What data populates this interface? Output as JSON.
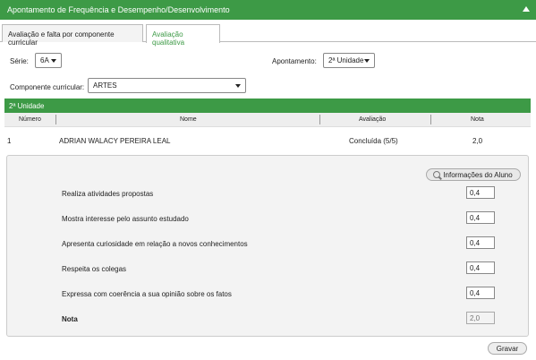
{
  "header": {
    "title": "Apontamento de Frequência e Desempenho/Desenvolvimento"
  },
  "tabs": [
    {
      "label": "Avaliação e falta por componente curricular"
    },
    {
      "label": "Avaliação qualitativa"
    }
  ],
  "filters": {
    "serie_label": "Série:",
    "serie_value": "6A",
    "apontamento_label": "Apontamento:",
    "apontamento_value": "2ª Unidade",
    "componente_label": "Componente curricular:",
    "componente_value": "ARTES"
  },
  "unit": {
    "title": "2ª Unidade"
  },
  "table": {
    "headers": [
      "Número",
      "Nome",
      "Avaliação",
      "Nota"
    ],
    "rows": [
      {
        "numero": "1",
        "nome": "ADRIAN WALACY PEREIRA LEAL",
        "avaliacao": "Concluída (5/5)",
        "nota": "2,0"
      }
    ]
  },
  "detail": {
    "info_button": "Informações do Aluno",
    "criteria": [
      {
        "label": "Realiza atividades propostas",
        "value": "0,4"
      },
      {
        "label": "Mostra interesse pelo assunto estudado",
        "value": "0,4"
      },
      {
        "label": "Apresenta curiosidade em relação a novos conhecimentos",
        "value": "0,4"
      },
      {
        "label": "Respeita os colegas",
        "value": "0,4"
      },
      {
        "label": "Expressa com coerência a sua opinião sobre os fatos",
        "value": "0,4"
      }
    ],
    "nota_label": "Nota",
    "nota_value": "2,0"
  },
  "actions": {
    "save": "Gravar"
  },
  "colors": {
    "accent": "#3d9a46"
  }
}
